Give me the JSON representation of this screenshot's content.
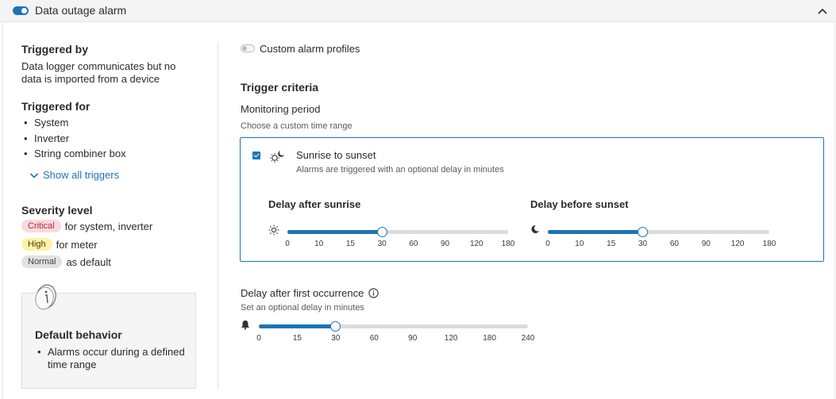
{
  "header": {
    "title": "Data outage alarm",
    "enabled": true
  },
  "left": {
    "triggered_by": {
      "heading": "Triggered by",
      "text_line1": "Data logger communicates but no",
      "text_line2": "data is imported from a device"
    },
    "triggered_for": {
      "heading": "Triggered for",
      "items": [
        "System",
        "Inverter",
        "String combiner box"
      ],
      "show_all_label": "Show all triggers"
    },
    "severity": {
      "heading": "Severity level",
      "rows": [
        {
          "badge": "Critical",
          "text": "for system, inverter"
        },
        {
          "badge": "High",
          "text": "for meter"
        },
        {
          "badge": "Normal",
          "text": "as default"
        }
      ]
    },
    "default_behavior": {
      "title": "Default behavior",
      "items": [
        "Alarms occur during a defined time range"
      ]
    }
  },
  "right": {
    "custom_profiles_label": "Custom alarm profiles",
    "custom_profiles_enabled": false,
    "trigger_criteria_title": "Trigger criteria",
    "monitoring_period_label": "Monitoring period",
    "monitoring_period_help": "Choose a custom time range",
    "option": {
      "checked": true,
      "title": "Sunrise to sunset",
      "description": "Alarms are triggered with an optional delay in minutes"
    },
    "delay_after_sunrise": {
      "label": "Delay after sunrise",
      "ticks": [
        "0",
        "10",
        "15",
        "30",
        "60",
        "90",
        "120",
        "180"
      ],
      "selected_index": 3,
      "value": "30"
    },
    "delay_before_sunset": {
      "label": "Delay before sunset",
      "ticks": [
        "0",
        "10",
        "15",
        "30",
        "60",
        "90",
        "120",
        "180"
      ],
      "selected_index": 3,
      "value": "30"
    },
    "first_occurrence": {
      "label": "Delay after first occurrence",
      "help": "Set an optional delay in minutes",
      "ticks": [
        "0",
        "15",
        "30",
        "60",
        "90",
        "120",
        "180",
        "240"
      ],
      "selected_index": 2,
      "value": "30"
    }
  },
  "colors": {
    "accent": "#1a75b8",
    "critical_bg": "#fbd9dd",
    "high_bg": "#fff2a8",
    "normal_bg": "#e2e2e2"
  }
}
